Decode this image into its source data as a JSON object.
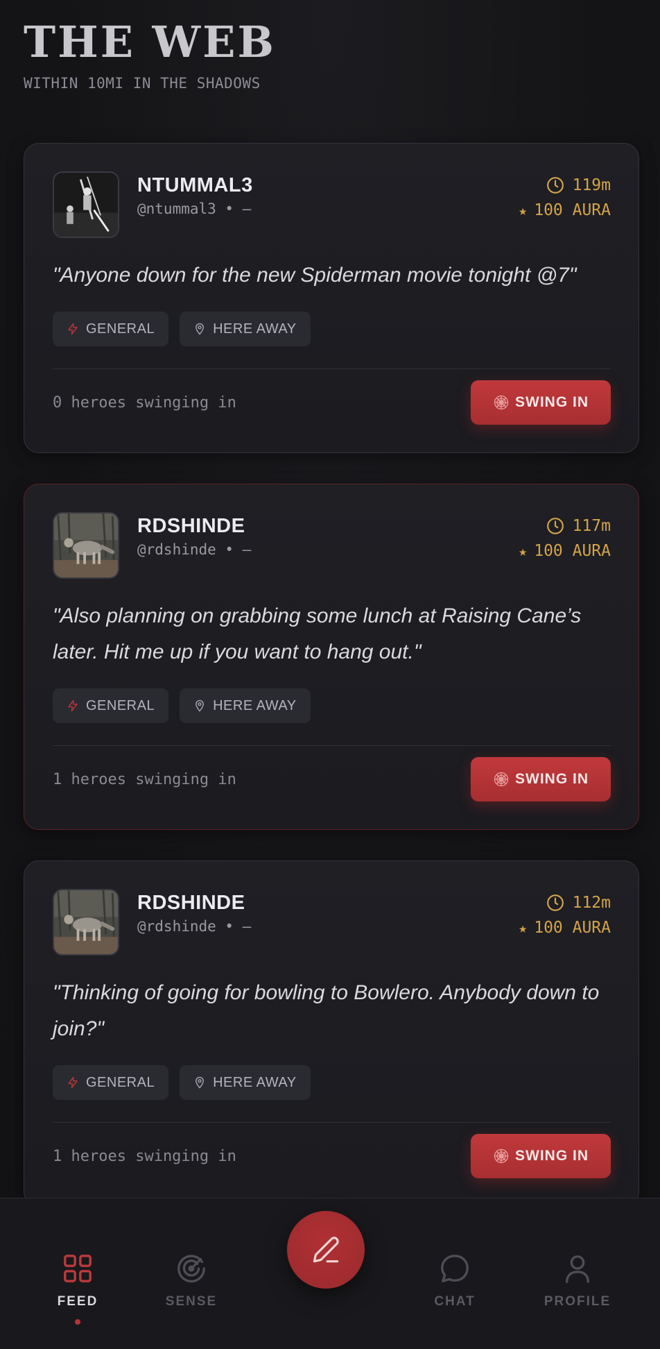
{
  "header": {
    "title": "THE WEB",
    "subtitle": "WITHIN 10MI IN THE SHADOWS"
  },
  "posts": [
    {
      "name": "NTUMMAL3",
      "handle": "@ntummal3 • —",
      "time": "119m",
      "aura": "100 AURA",
      "quote": "\"Anyone down for the new Spiderman movie tonight @7\"",
      "tags": [
        "GENERAL",
        "HERE AWAY"
      ],
      "heroes": "0 heroes swinging in",
      "button": "SWING IN",
      "avatar": "person-avatar"
    },
    {
      "name": "RDSHINDE",
      "handle": "@rdshinde • —",
      "time": "117m",
      "aura": "100 AURA",
      "quote": "\"Also planning on grabbing some lunch at Raising Cane’s later. Hit me up if you want to hang out.\"",
      "tags": [
        "GENERAL",
        "HERE AWAY"
      ],
      "heroes": "1 heroes swinging in",
      "button": "SWING IN",
      "avatar": "coyote-avatar"
    },
    {
      "name": "RDSHINDE",
      "handle": "@rdshinde • —",
      "time": "112m",
      "aura": "100 AURA",
      "quote": "\"Thinking of going for bowling to Bowlero. Anybody down to join?\"",
      "tags": [
        "GENERAL",
        "HERE AWAY"
      ],
      "heroes": "1 heroes swinging in",
      "button": "SWING IN",
      "avatar": "coyote-avatar"
    }
  ],
  "nav": {
    "items": [
      {
        "label": "FEED",
        "icon": "grid-icon",
        "active": true
      },
      {
        "label": "SENSE",
        "icon": "radar-icon",
        "active": false
      },
      {
        "label": "CHAT",
        "icon": "chat-bubble-icon",
        "active": false
      },
      {
        "label": "PROFILE",
        "icon": "user-icon",
        "active": false
      }
    ],
    "compose_icon": "pencil-icon"
  },
  "colors": {
    "accent": "#b83436",
    "gold": "#d4a449",
    "background": "#141416",
    "card": "#1e1e23"
  }
}
